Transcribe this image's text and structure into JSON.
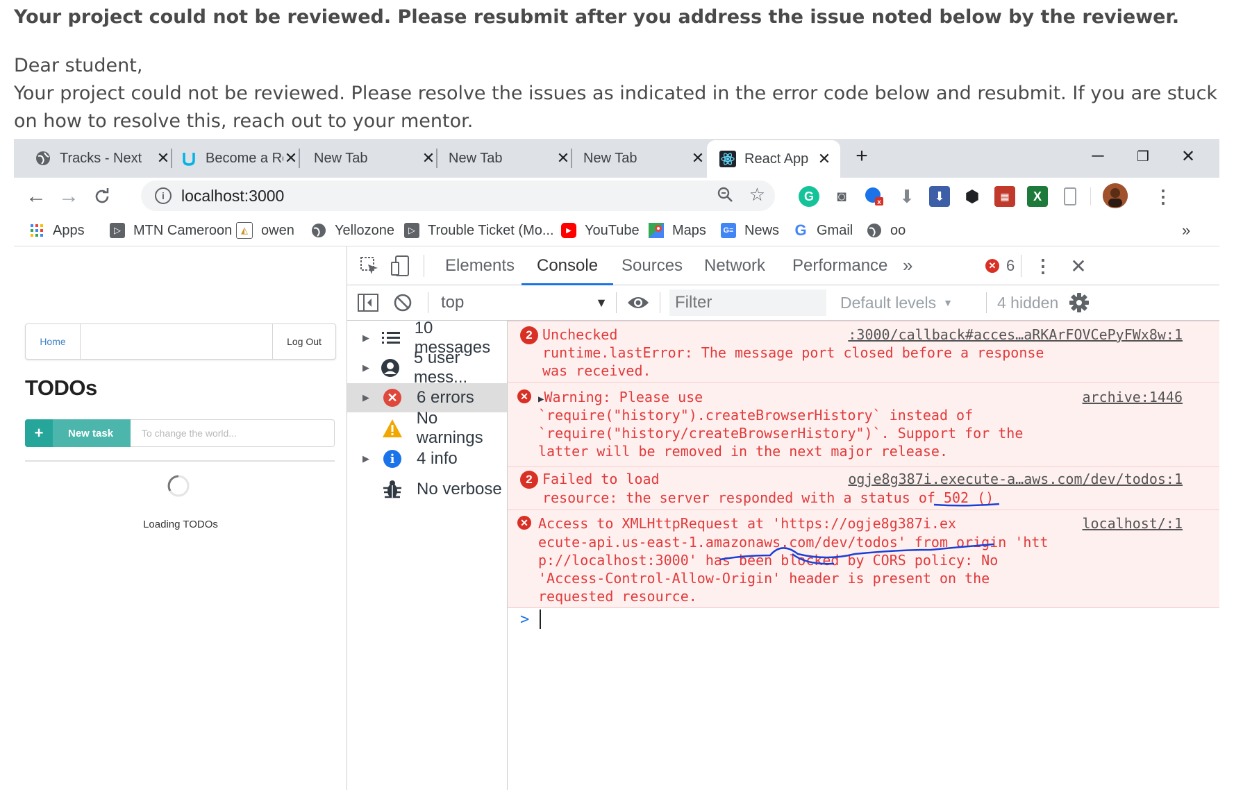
{
  "review": {
    "headline": "Your project could not be reviewed. Please resubmit after you address the issue noted below by the reviewer.",
    "greeting": "Dear student,",
    "body": "Your project could not be reviewed. Please resolve the issues as indicated in the error code below and resubmit. If you are stuck on how to resolve this, reach out to your mentor."
  },
  "browser": {
    "tabs": [
      {
        "title": "Tracks - Next",
        "icon": "globe-icon"
      },
      {
        "title": "Become a Re",
        "icon": "udacity-icon"
      },
      {
        "title": "New Tab",
        "icon": ""
      },
      {
        "title": "New Tab",
        "icon": ""
      },
      {
        "title": "New Tab",
        "icon": ""
      },
      {
        "title": "React App",
        "icon": "react-icon",
        "active": true
      }
    ],
    "new_tab": "+",
    "url": "localhost:3000",
    "bookmarks": [
      {
        "label": "Apps",
        "icon": "apps-grid-icon"
      },
      {
        "label": "MTN Cameroon",
        "icon": "play-icon"
      },
      {
        "label": "owen",
        "icon": "image-icon"
      },
      {
        "label": "Yellozone",
        "icon": "globe-icon"
      },
      {
        "label": "Trouble Ticket (Mo...",
        "icon": "play-icon"
      },
      {
        "label": "YouTube",
        "icon": "youtube-icon"
      },
      {
        "label": "Maps",
        "icon": "maps-icon"
      },
      {
        "label": "News",
        "icon": "news-icon"
      },
      {
        "label": "Gmail",
        "icon": "google-icon"
      },
      {
        "label": "oo",
        "icon": "globe-icon"
      }
    ],
    "more_bookmarks": "»"
  },
  "app": {
    "home": "Home",
    "logout": "Log Out",
    "title": "TODOs",
    "new_task_button": "New task",
    "new_task_placeholder": "To change the world...",
    "loading": "Loading TODOs"
  },
  "devtools": {
    "tabs": [
      "Elements",
      "Console",
      "Sources",
      "Network",
      "Performance"
    ],
    "active_tab": "Console",
    "more": "»",
    "error_count": "6",
    "context": "top",
    "filter_placeholder": "Filter",
    "levels": "Default levels",
    "hidden": "4 hidden",
    "sidebar": [
      {
        "label": "10 messages",
        "icon": "list-icon",
        "expandable": true
      },
      {
        "label": "5 user mess...",
        "icon": "user-icon",
        "expandable": true
      },
      {
        "label": "6 errors",
        "icon": "error-icon",
        "expandable": true,
        "selected": true
      },
      {
        "label": "No warnings",
        "icon": "warning-icon",
        "expandable": false
      },
      {
        "label": "4 info",
        "icon": "info-icon",
        "expandable": true
      },
      {
        "label": "No verbose",
        "icon": "bug-icon",
        "expandable": false
      }
    ],
    "messages": [
      {
        "count": "2",
        "lines": [
          "Unchecked",
          "runtime.lastError: The message port closed before a response",
          "was received."
        ],
        "source": ":3000/callback#acces…aRKArFOVCePyFWx8w:1"
      },
      {
        "lines": [
          "Warning: Please use",
          "`require(\"history\").createBrowserHistory` instead of",
          "`require(\"history/createBrowserHistory\")`. Support for the",
          "latter will be removed in the next major release."
        ],
        "source": "archive:1446"
      },
      {
        "count": "2",
        "lines": [
          "Failed to load",
          "resource: the server responded with a status of 502 ()"
        ],
        "source": "ogje8g387i.execute-a…aws.com/dev/todos:1"
      },
      {
        "lines": [
          "Access to XMLHttpRequest at 'https://ogje8g387i.ex",
          "ecute-api.us-east-1.amazonaws.com/dev/todos' from origin 'htt",
          "p://localhost:3000' has been blocked by CORS policy: No",
          "'Access-Control-Allow-Origin' header is present on the",
          "requested resource."
        ],
        "source": "localhost/:1"
      }
    ],
    "prompt": ">"
  },
  "colors": {
    "error": "#e03a3a",
    "error_bg": "#fff0f0",
    "accent": "#1a73e8",
    "teal": "#4db6ac",
    "annotation": "#1a3fd6"
  }
}
